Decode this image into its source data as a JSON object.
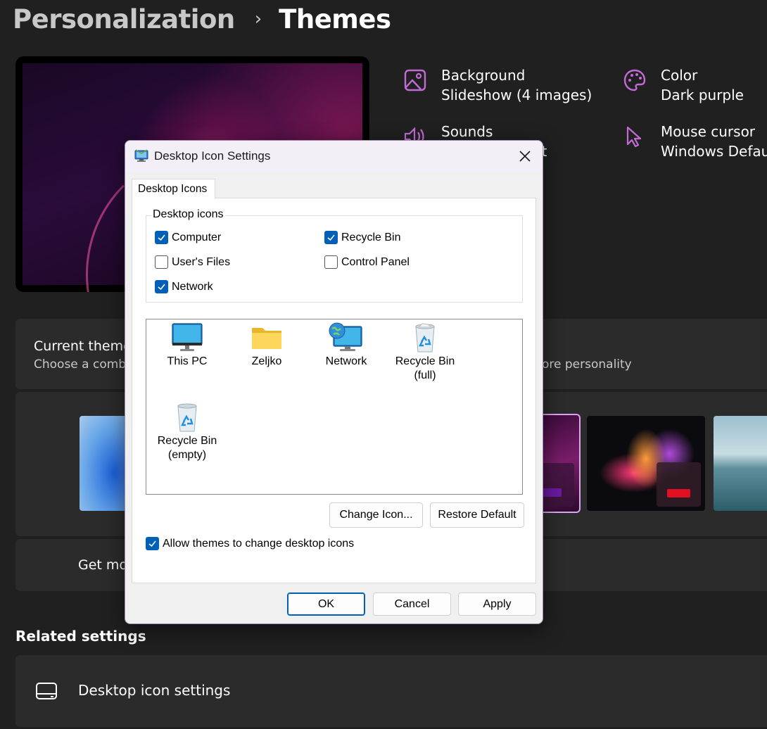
{
  "header": {
    "parent": "Personalization",
    "separator": "›",
    "current": "Themes"
  },
  "theme_properties": [
    {
      "icon": "image-icon",
      "label": "Background",
      "value": "Slideshow (4 images)"
    },
    {
      "icon": "palette-icon",
      "label": "Color",
      "value": "Dark purple"
    },
    {
      "icon": "speaker-icon",
      "label": "Sounds",
      "value": "lt"
    },
    {
      "icon": "mouse-pointer-icon",
      "label": "Mouse cursor",
      "value": "Windows Defaul"
    }
  ],
  "current_theme": {
    "title": "Current theme",
    "subtitle": "Choose a combi",
    "subtitle_tail": "ore personality"
  },
  "get_more": {
    "label": "Get mo"
  },
  "related_settings": {
    "heading": "Related settings",
    "items": [
      {
        "icon": "desktop-icon",
        "label": "Desktop icon settings"
      }
    ]
  },
  "dialog": {
    "title": "Desktop Icon Settings",
    "tab": "Desktop Icons",
    "group_label": "Desktop icons",
    "checkboxes": [
      {
        "label": "Computer",
        "checked": true
      },
      {
        "label": "Recycle Bin",
        "checked": true
      },
      {
        "label": "User's Files",
        "checked": false
      },
      {
        "label": "Control Panel",
        "checked": false
      },
      {
        "label": "Network",
        "checked": true
      }
    ],
    "icons": [
      {
        "icon": "monitor-icon",
        "caption": "This PC"
      },
      {
        "icon": "folder-icon",
        "caption": "Zeljko"
      },
      {
        "icon": "network-icon",
        "caption": "Network"
      },
      {
        "icon": "recycle-bin-full-icon",
        "caption": "Recycle Bin\n(full)"
      },
      {
        "icon": "recycle-bin-empty-icon",
        "caption": "Recycle Bin\n(empty)"
      }
    ],
    "buttons": {
      "change_icon": "Change Icon...",
      "restore_default": "Restore Default",
      "ok": "OK",
      "cancel": "Cancel",
      "apply": "Apply"
    },
    "allow_themes": {
      "label": "Allow themes to change desktop icons",
      "checked": true
    }
  },
  "colors": {
    "accent_purple": "#c36ad7",
    "checkbox_blue": "#005fb8",
    "page_bg": "#202020",
    "card_bg": "#2b2b2b"
  }
}
